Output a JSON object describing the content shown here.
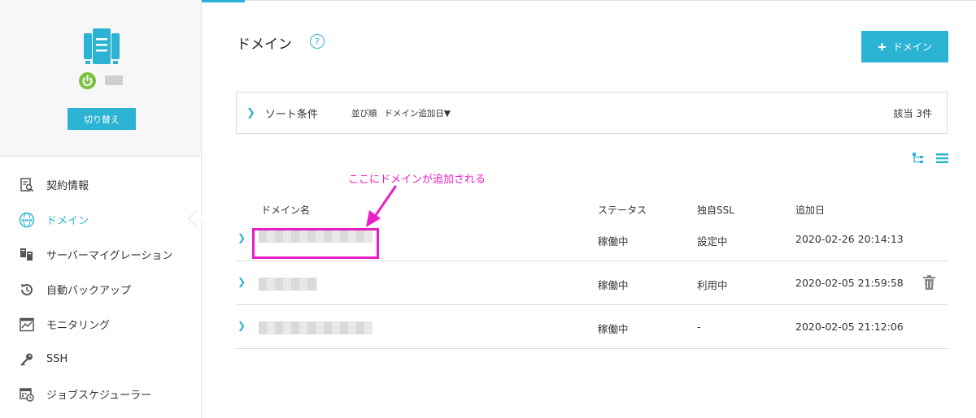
{
  "sidebar": {
    "switch_label": "切り替え",
    "items": [
      {
        "label": "契約情報",
        "icon": "contract-search-icon"
      },
      {
        "label": "ドメイン",
        "icon": "www-globe-icon",
        "active": true
      },
      {
        "label": "サーバーマイグレーション",
        "icon": "server-migration-icon"
      },
      {
        "label": "自動バックアップ",
        "icon": "backup-clock-icon"
      },
      {
        "label": "モニタリング",
        "icon": "monitoring-chart-icon"
      },
      {
        "label": "SSH",
        "icon": "key-icon"
      },
      {
        "label": "ジョブスケジューラー",
        "icon": "scheduler-calendar-icon"
      }
    ]
  },
  "main": {
    "title": "ドメイン",
    "help_glyph": "?",
    "add_button_label": "ドメイン",
    "add_button_plus": "+",
    "sort": {
      "chevron": "❯",
      "title": "ソート条件",
      "label": "並び順",
      "value": "ドメイン追加日▼",
      "count": "該当 3件"
    },
    "annotation": "ここにドメインが追加される",
    "columns": [
      "ドメイン名",
      "ステータス",
      "独自SSL",
      "追加日"
    ],
    "rows": [
      {
        "status": "稼働中",
        "ssl": "設定中",
        "added": "2020-02-26 20:14:13"
      },
      {
        "status": "稼働中",
        "ssl": "利用中",
        "added": "2020-02-05 21:59:58"
      },
      {
        "status": "稼働中",
        "ssl": "-",
        "added": "2020-02-05 21:12:06"
      }
    ]
  },
  "colors": {
    "accent": "#2bb3d3",
    "annotation": "#e91ec6",
    "power": "#7cc242"
  }
}
